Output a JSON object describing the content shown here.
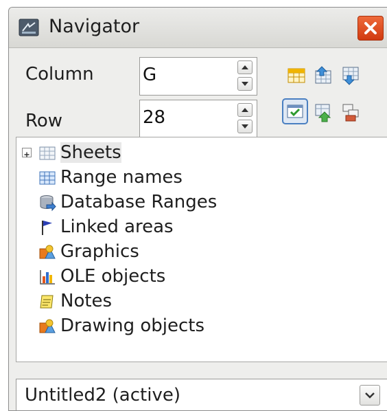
{
  "window": {
    "title": "Navigator",
    "close_icon": "close-icon"
  },
  "fields": {
    "column_label": "Column",
    "column_value": "G",
    "row_label": "Row",
    "row_value": "28"
  },
  "toolbar": {
    "icons": [
      "data-range-icon",
      "start-icon",
      "end-icon",
      "toggle-contents-icon",
      "scenarios-icon",
      "drag-mode-icon"
    ]
  },
  "tree": {
    "items": [
      {
        "label": "Sheets",
        "icon": "sheet-grid-icon",
        "expandable": true
      },
      {
        "label": "Range names",
        "icon": "range-names-icon"
      },
      {
        "label": "Database Ranges",
        "icon": "database-icon"
      },
      {
        "label": "Linked areas",
        "icon": "flag-icon"
      },
      {
        "label": "Graphics",
        "icon": "graphics-icon"
      },
      {
        "label": "OLE objects",
        "icon": "ole-chart-icon"
      },
      {
        "label": "Notes",
        "icon": "note-icon"
      },
      {
        "label": "Drawing objects",
        "icon": "drawing-icon"
      }
    ]
  },
  "document_select": {
    "value": "Untitled2 (active)"
  }
}
